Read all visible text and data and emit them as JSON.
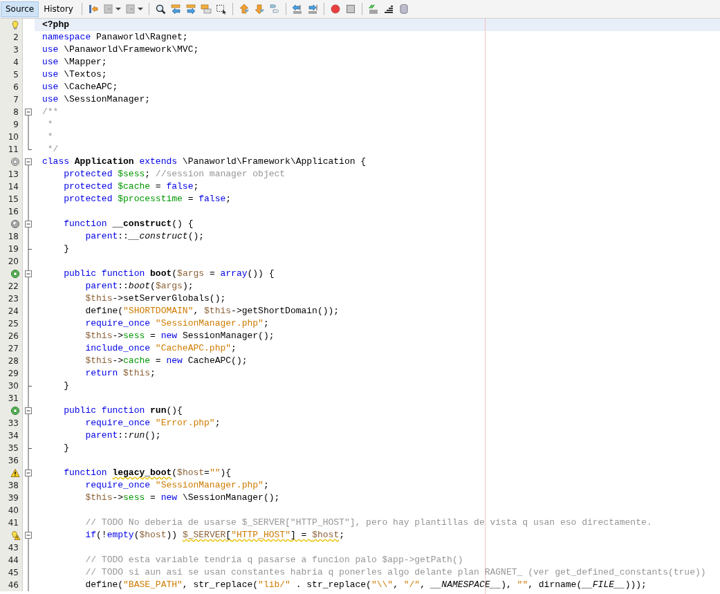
{
  "tabs": [
    {
      "label": "Source",
      "selected": true
    },
    {
      "label": "History",
      "selected": false
    }
  ],
  "lines": [
    {
      "marker": {
        "kind": "hint"
      },
      "current": true,
      "tokens": [
        {
          "kind": "bold",
          "text": "<?php"
        }
      ]
    },
    {
      "number": "2",
      "current": false,
      "tokens": [
        {
          "kind": "kw",
          "text": "namespace"
        },
        {
          "kind": "plain",
          "text": " Panaworld\\Ragnet;"
        }
      ]
    },
    {
      "number": "3",
      "current": false,
      "tokens": [
        {
          "kind": "kw",
          "text": "use"
        },
        {
          "kind": "plain",
          "text": " \\Panaworld\\Framework\\MVC;"
        }
      ]
    },
    {
      "number": "4",
      "current": false,
      "tokens": [
        {
          "kind": "kw",
          "text": "use"
        },
        {
          "kind": "plain",
          "text": " \\Mapper;"
        }
      ]
    },
    {
      "number": "5",
      "current": false,
      "tokens": [
        {
          "kind": "kw",
          "text": "use"
        },
        {
          "kind": "plain",
          "text": " \\Textos;"
        }
      ]
    },
    {
      "number": "6",
      "current": false,
      "tokens": [
        {
          "kind": "kw",
          "text": "use"
        },
        {
          "kind": "plain",
          "text": " \\CacheAPC;"
        }
      ]
    },
    {
      "number": "7",
      "current": false,
      "tokens": [
        {
          "kind": "kw",
          "text": "use"
        },
        {
          "kind": "plain",
          "text": " \\SessionManager;"
        }
      ]
    },
    {
      "number": "8",
      "current": false,
      "fold": {
        "kind": "start"
      },
      "tokens": [
        {
          "kind": "comment",
          "text": "/**"
        }
      ]
    },
    {
      "number": "9",
      "current": false,
      "fold": {
        "kind": "inner"
      },
      "tokens": [
        {
          "kind": "comment",
          "text": " *"
        }
      ]
    },
    {
      "number": "10",
      "current": false,
      "fold": {
        "kind": "inner"
      },
      "tokens": [
        {
          "kind": "comment",
          "text": " *"
        }
      ]
    },
    {
      "number": "11",
      "current": false,
      "fold": {
        "kind": "end"
      },
      "tokens": [
        {
          "kind": "comment",
          "text": " */"
        }
      ]
    },
    {
      "marker": {
        "kind": "overrides"
      },
      "current": false,
      "fold": {
        "kind": "start"
      },
      "tokens": [
        {
          "kind": "kw",
          "text": "class "
        },
        {
          "kind": "bold",
          "text": "Application"
        },
        {
          "kind": "kw",
          "text": " extends"
        },
        {
          "kind": "plain",
          "text": " \\Panaworld\\Framework\\Application {"
        }
      ]
    },
    {
      "number": "13",
      "current": false,
      "fold": {
        "kind": "inner"
      },
      "tokens": [
        {
          "kind": "kw",
          "text": "    protected "
        },
        {
          "kind": "field",
          "text": "$sess"
        },
        {
          "kind": "plain",
          "text": "; "
        },
        {
          "kind": "comment",
          "text": "//session manager object"
        }
      ]
    },
    {
      "number": "14",
      "current": false,
      "fold": {
        "kind": "inner"
      },
      "tokens": [
        {
          "kind": "kw",
          "text": "    protected "
        },
        {
          "kind": "field",
          "text": "$cache"
        },
        {
          "kind": "plain",
          "text": " = "
        },
        {
          "kind": "kw",
          "text": "false"
        },
        {
          "kind": "plain",
          "text": ";"
        }
      ]
    },
    {
      "number": "15",
      "current": false,
      "fold": {
        "kind": "inner"
      },
      "tokens": [
        {
          "kind": "kw",
          "text": "    protected "
        },
        {
          "kind": "field",
          "text": "$processtime"
        },
        {
          "kind": "plain",
          "text": " = "
        },
        {
          "kind": "kw",
          "text": "false"
        },
        {
          "kind": "plain",
          "text": ";"
        }
      ]
    },
    {
      "number": "16",
      "current": false,
      "fold": {
        "kind": "inner"
      }
    },
    {
      "marker": {
        "kind": "overridden"
      },
      "current": false,
      "fold": {
        "kind": "nested-start"
      },
      "tokens": [
        {
          "kind": "kw",
          "text": "    function "
        },
        {
          "kind": "bold",
          "text": "__construct"
        },
        {
          "kind": "plain",
          "text": "() {"
        }
      ]
    },
    {
      "number": "18",
      "current": false,
      "fold": {
        "kind": "inner"
      },
      "tokens": [
        {
          "kind": "kw",
          "text": "        parent"
        },
        {
          "kind": "plain",
          "text": "::"
        },
        {
          "kind": "italic",
          "text": "__construct"
        },
        {
          "kind": "plain",
          "text": "();"
        }
      ]
    },
    {
      "number": "19",
      "current": false,
      "fold": {
        "kind": "nested-end"
      },
      "tokens": [
        {
          "kind": "plain",
          "text": "    }"
        }
      ]
    },
    {
      "number": "20",
      "current": false,
      "fold": {
        "kind": "inner"
      }
    },
    {
      "marker": {
        "kind": "implements"
      },
      "current": false,
      "fold": {
        "kind": "nested-start"
      },
      "tokens": [
        {
          "kind": "kw",
          "text": "    public function "
        },
        {
          "kind": "bold",
          "text": "boot"
        },
        {
          "kind": "plain",
          "text": "("
        },
        {
          "kind": "var",
          "text": "$args"
        },
        {
          "kind": "plain",
          "text": " = "
        },
        {
          "kind": "kw",
          "text": "array"
        },
        {
          "kind": "plain",
          "text": "()) {"
        }
      ]
    },
    {
      "number": "22",
      "current": false,
      "fold": {
        "kind": "inner"
      },
      "tokens": [
        {
          "kind": "kw",
          "text": "        parent"
        },
        {
          "kind": "plain",
          "text": "::"
        },
        {
          "kind": "italic",
          "text": "boot"
        },
        {
          "kind": "plain",
          "text": "("
        },
        {
          "kind": "var",
          "text": "$args"
        },
        {
          "kind": "plain",
          "text": ");"
        }
      ]
    },
    {
      "number": "23",
      "current": false,
      "fold": {
        "kind": "inner"
      },
      "tokens": [
        {
          "kind": "var",
          "text": "        $this"
        },
        {
          "kind": "plain",
          "text": "->setServerGlobals();"
        }
      ]
    },
    {
      "number": "24",
      "current": false,
      "fold": {
        "kind": "inner"
      },
      "tokens": [
        {
          "kind": "plain",
          "text": "        define("
        },
        {
          "kind": "str",
          "text": "\"SHORTDOMAIN\""
        },
        {
          "kind": "plain",
          "text": ", "
        },
        {
          "kind": "var",
          "text": "$this"
        },
        {
          "kind": "plain",
          "text": "->getShortDomain());"
        }
      ]
    },
    {
      "number": "25",
      "current": false,
      "fold": {
        "kind": "inner"
      },
      "tokens": [
        {
          "kind": "kw",
          "text": "        require_once "
        },
        {
          "kind": "str",
          "text": "\"SessionManager.php\""
        },
        {
          "kind": "plain",
          "text": ";"
        }
      ]
    },
    {
      "number": "26",
      "current": false,
      "fold": {
        "kind": "inner"
      },
      "tokens": [
        {
          "kind": "var",
          "text": "        $this"
        },
        {
          "kind": "plain",
          "text": "->"
        },
        {
          "kind": "field",
          "text": "sess"
        },
        {
          "kind": "plain",
          "text": " = "
        },
        {
          "kind": "kw",
          "text": "new"
        },
        {
          "kind": "plain",
          "text": " SessionManager();"
        }
      ]
    },
    {
      "number": "27",
      "current": false,
      "fold": {
        "kind": "inner"
      },
      "tokens": [
        {
          "kind": "kw",
          "text": "        include_once "
        },
        {
          "kind": "str",
          "text": "\"CacheAPC.php\""
        },
        {
          "kind": "plain",
          "text": ";"
        }
      ]
    },
    {
      "number": "28",
      "current": false,
      "fold": {
        "kind": "inner"
      },
      "tokens": [
        {
          "kind": "var",
          "text": "        $this"
        },
        {
          "kind": "plain",
          "text": "->"
        },
        {
          "kind": "field",
          "text": "cache"
        },
        {
          "kind": "plain",
          "text": " = "
        },
        {
          "kind": "kw",
          "text": "new"
        },
        {
          "kind": "plain",
          "text": " CacheAPC();"
        }
      ]
    },
    {
      "number": "29",
      "current": false,
      "fold": {
        "kind": "inner"
      },
      "tokens": [
        {
          "kind": "kw",
          "text": "        return "
        },
        {
          "kind": "var",
          "text": "$this"
        },
        {
          "kind": "plain",
          "text": ";"
        }
      ]
    },
    {
      "number": "30",
      "current": false,
      "fold": {
        "kind": "nested-end"
      },
      "tokens": [
        {
          "kind": "plain",
          "text": "    }"
        }
      ]
    },
    {
      "number": "31",
      "current": false,
      "fold": {
        "kind": "inner"
      }
    },
    {
      "marker": {
        "kind": "implements"
      },
      "current": false,
      "fold": {
        "kind": "nested-start"
      },
      "tokens": [
        {
          "kind": "kw",
          "text": "    public function "
        },
        {
          "kind": "bold",
          "text": "run"
        },
        {
          "kind": "plain",
          "text": "(){"
        }
      ]
    },
    {
      "number": "33",
      "current": false,
      "fold": {
        "kind": "inner"
      },
      "tokens": [
        {
          "kind": "kw",
          "text": "        require_once "
        },
        {
          "kind": "str",
          "text": "\"Error.php\""
        },
        {
          "kind": "plain",
          "text": ";"
        }
      ]
    },
    {
      "number": "34",
      "current": false,
      "fold": {
        "kind": "inner"
      },
      "tokens": [
        {
          "kind": "kw",
          "text": "        parent"
        },
        {
          "kind": "plain",
          "text": "::"
        },
        {
          "kind": "italic",
          "text": "run"
        },
        {
          "kind": "plain",
          "text": "();"
        }
      ]
    },
    {
      "number": "35",
      "current": false,
      "fold": {
        "kind": "nested-end"
      },
      "tokens": [
        {
          "kind": "plain",
          "text": "    }"
        }
      ]
    },
    {
      "number": "36",
      "current": false,
      "fold": {
        "kind": "inner"
      }
    },
    {
      "marker": {
        "kind": "warning"
      },
      "current": false,
      "fold": {
        "kind": "nested-start"
      },
      "tokens": [
        {
          "kind": "kw",
          "text": "    function "
        },
        {
          "kind": "bold",
          "text": "legacy_boot",
          "squiggle": true
        },
        {
          "kind": "plain",
          "text": "("
        },
        {
          "kind": "var",
          "text": "$host"
        },
        {
          "kind": "plain",
          "text": "="
        },
        {
          "kind": "str",
          "text": "\"\""
        },
        {
          "kind": "plain",
          "text": "){"
        }
      ]
    },
    {
      "number": "38",
      "current": false,
      "fold": {
        "kind": "inner"
      },
      "tokens": [
        {
          "kind": "kw",
          "text": "        require_once "
        },
        {
          "kind": "str",
          "text": "\"SessionManager.php\""
        },
        {
          "kind": "plain",
          "text": ";"
        }
      ]
    },
    {
      "number": "39",
      "current": false,
      "fold": {
        "kind": "inner"
      },
      "tokens": [
        {
          "kind": "var",
          "text": "        $this"
        },
        {
          "kind": "plain",
          "text": "->"
        },
        {
          "kind": "field",
          "text": "sess"
        },
        {
          "kind": "plain",
          "text": " = "
        },
        {
          "kind": "kw",
          "text": "new"
        },
        {
          "kind": "plain",
          "text": " \\SessionManager();"
        }
      ]
    },
    {
      "number": "40",
      "current": false,
      "fold": {
        "kind": "inner"
      }
    },
    {
      "number": "41",
      "current": false,
      "fold": {
        "kind": "inner"
      },
      "tokens": [
        {
          "kind": "comment",
          "text": "        // TODO No deberia de usarse $_SERVER[\"HTTP_HOST\"], pero hay plantillas de vista q usan eso directamente."
        }
      ]
    },
    {
      "marker": {
        "kind": "hint-warning"
      },
      "current": false,
      "fold": {
        "kind": "nested-start"
      },
      "tokens": [
        {
          "kind": "kw",
          "text": "        if"
        },
        {
          "kind": "plain",
          "text": "(!"
        },
        {
          "kind": "kw",
          "text": "empty"
        },
        {
          "kind": "plain",
          "text": "("
        },
        {
          "kind": "var",
          "text": "$host"
        },
        {
          "kind": "plain",
          "text": ")) "
        },
        {
          "kind": "var",
          "text": "$_SERVER",
          "squiggle": true
        },
        {
          "kind": "plain",
          "text": "[",
          "squiggle": true
        },
        {
          "kind": "str",
          "text": "\"HTTP_HOST\"",
          "squiggle": true
        },
        {
          "kind": "plain",
          "text": "] = ",
          "squiggle": true
        },
        {
          "kind": "var",
          "text": "$host",
          "squiggle": true
        },
        {
          "kind": "plain",
          "text": ";"
        }
      ]
    },
    {
      "number": "43",
      "current": false,
      "fold": {
        "kind": "inner"
      }
    },
    {
      "number": "44",
      "current": false,
      "fold": {
        "kind": "inner"
      },
      "tokens": [
        {
          "kind": "comment",
          "text": "        // TODO esta variable tendria q pasarse a funcion palo $app->getPath()"
        }
      ]
    },
    {
      "number": "45",
      "current": false,
      "fold": {
        "kind": "inner"
      },
      "tokens": [
        {
          "kind": "comment",
          "text": "        // TODO si aun asi se usan constantes habria q ponerles algo delante plan RAGNET_ (ver get_defined_constants(true))"
        }
      ]
    },
    {
      "number": "46",
      "current": false,
      "fold": {
        "kind": "inner"
      },
      "tokens": [
        {
          "kind": "plain",
          "text": "        define("
        },
        {
          "kind": "str",
          "text": "\"BASE_PATH\""
        },
        {
          "kind": "plain",
          "text": ", str_replace("
        },
        {
          "kind": "str",
          "text": "\"lib/\""
        },
        {
          "kind": "plain",
          "text": " . str_replace("
        },
        {
          "kind": "str",
          "text": "\"\\\\\""
        },
        {
          "kind": "plain",
          "text": ", "
        },
        {
          "kind": "str",
          "text": "\"/\""
        },
        {
          "kind": "plain",
          "text": ", "
        },
        {
          "kind": "italic",
          "text": "__NAMESPACE__"
        },
        {
          "kind": "plain",
          "text": "), "
        },
        {
          "kind": "str",
          "text": "\"\""
        },
        {
          "kind": "plain",
          "text": ", dirname("
        },
        {
          "kind": "italic",
          "text": "__FILE__"
        },
        {
          "kind": "plain",
          "text": ")));"
        }
      ]
    }
  ]
}
